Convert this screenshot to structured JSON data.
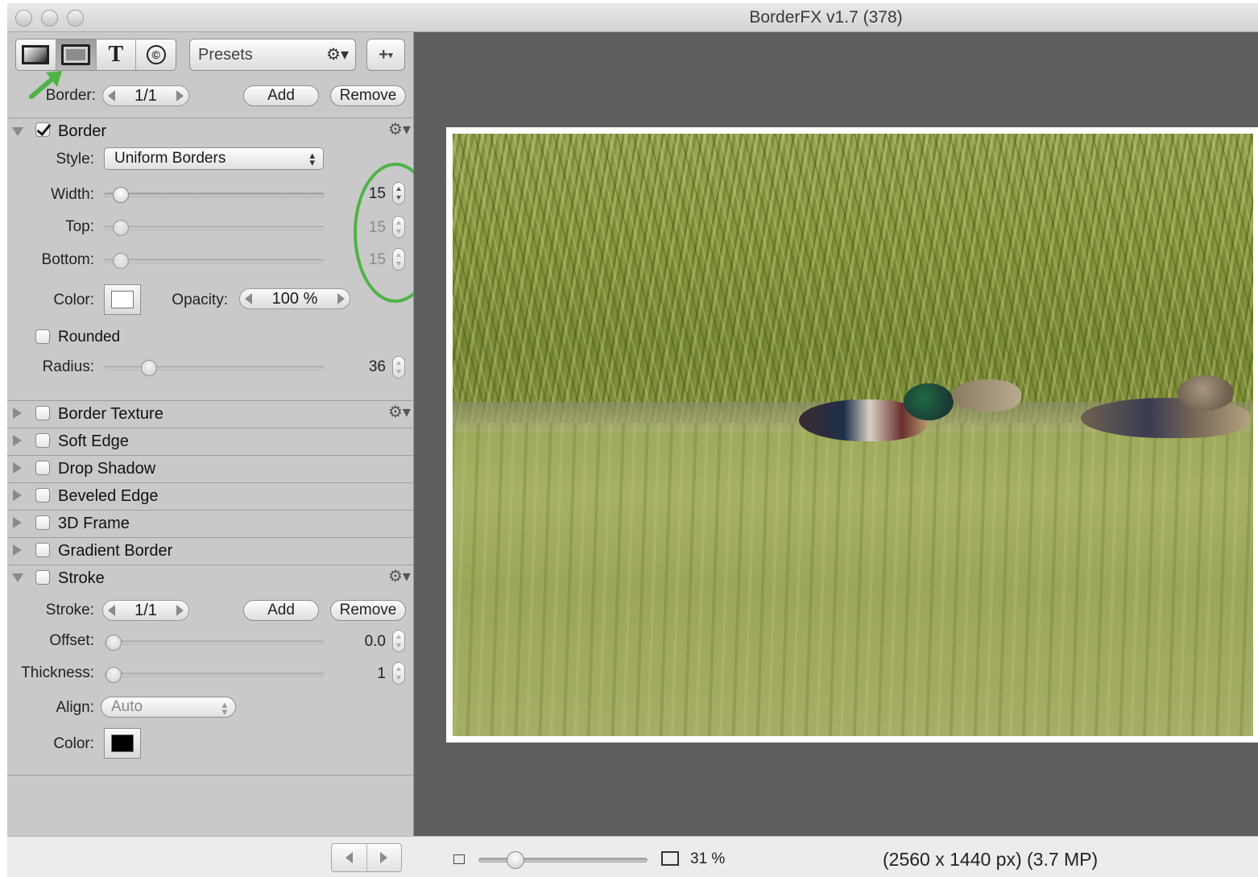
{
  "window": {
    "title": "BorderFX v1.7 (378)"
  },
  "toolbar": {
    "presets_label": "Presets",
    "gear_icon": "gear-icon",
    "add_label": "+",
    "text_tool": "T",
    "copyright_tool": "©"
  },
  "border_nav": {
    "label": "Border:",
    "counter": "1/1",
    "add": "Add",
    "remove": "Remove"
  },
  "border_section": {
    "title": "Border",
    "checked": true,
    "style_label": "Style:",
    "style_value": "Uniform Borders",
    "width_label": "Width:",
    "width_value": "15",
    "top_label": "Top:",
    "top_value": "15",
    "bottom_label": "Bottom:",
    "bottom_value": "15",
    "color_label": "Color:",
    "color": "#ffffff",
    "opacity_label": "Opacity:",
    "opacity_value": "100 %",
    "rounded_label": "Rounded",
    "radius_label": "Radius:",
    "radius_value": "36"
  },
  "collapsed_sections": [
    {
      "title": "Border Texture"
    },
    {
      "title": "Soft Edge"
    },
    {
      "title": "Drop Shadow"
    },
    {
      "title": "Beveled Edge"
    },
    {
      "title": "3D Frame"
    },
    {
      "title": "Gradient Border"
    }
  ],
  "stroke_section": {
    "title": "Stroke",
    "stroke_label": "Stroke:",
    "counter": "1/1",
    "add": "Add",
    "remove": "Remove",
    "offset_label": "Offset:",
    "offset_value": "0.0",
    "thickness_label": "Thickness:",
    "thickness_value": "1",
    "align_label": "Align:",
    "align_value": "Auto",
    "color_label": "Color:",
    "color": "#000000"
  },
  "statusbar": {
    "zoom": "31 %",
    "dimensions": "(2560 x 1440 px) (3.7 MP)"
  },
  "annotation_color": "#4fb346"
}
